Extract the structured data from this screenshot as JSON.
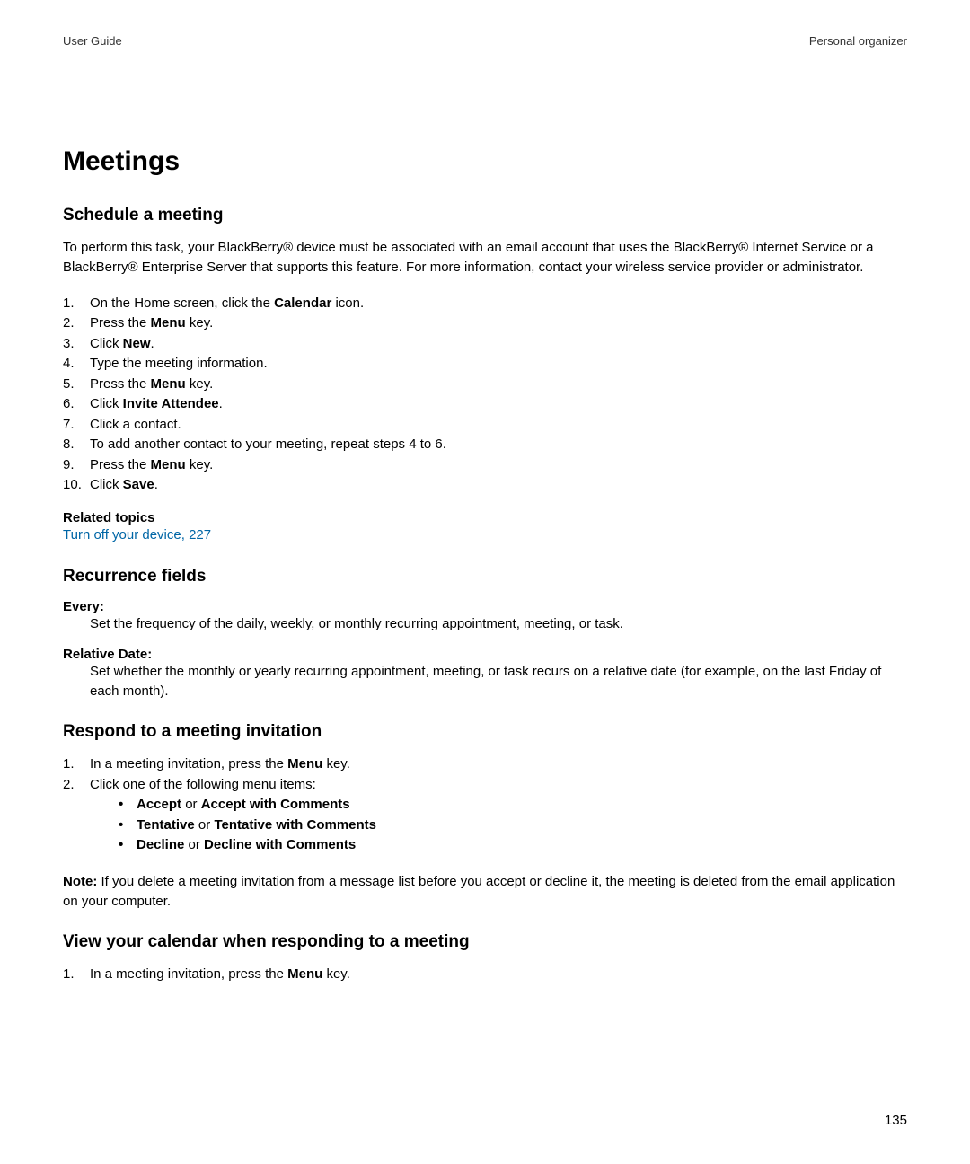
{
  "header": {
    "left": "User Guide",
    "right": "Personal organizer"
  },
  "title": "Meetings",
  "sections": {
    "schedule": {
      "heading": "Schedule a meeting",
      "intro": "To perform this task, your BlackBerry® device must be associated with an email account that uses the BlackBerry® Internet Service or a BlackBerry® Enterprise Server that supports this feature. For more information, contact your wireless service provider or administrator.",
      "steps": [
        {
          "pre": "On the Home screen, click the ",
          "bold": "Calendar",
          "post": " icon."
        },
        {
          "pre": "Press the ",
          "bold": "Menu",
          "post": " key."
        },
        {
          "pre": "Click ",
          "bold": "New",
          "post": "."
        },
        {
          "pre": "Type the meeting information.",
          "bold": "",
          "post": ""
        },
        {
          "pre": "Press the ",
          "bold": "Menu",
          "post": " key."
        },
        {
          "pre": "Click ",
          "bold": "Invite Attendee",
          "post": "."
        },
        {
          "pre": "Click a contact.",
          "bold": "",
          "post": ""
        },
        {
          "pre": "To add another contact to your meeting, repeat steps 4 to 6.",
          "bold": "",
          "post": ""
        },
        {
          "pre": "Press the ",
          "bold": "Menu",
          "post": " key."
        },
        {
          "pre": "Click ",
          "bold": "Save",
          "post": "."
        }
      ],
      "related_heading": "Related topics",
      "related_link": "Turn off your device, 227"
    },
    "recurrence": {
      "heading": "Recurrence fields",
      "defs": [
        {
          "term": "Every:",
          "def": "Set the frequency of the daily, weekly, or monthly recurring appointment, meeting, or task."
        },
        {
          "term": "Relative Date:",
          "def": "Set whether the monthly or yearly recurring appointment, meeting, or task recurs on a relative date (for example, on the last Friday of each month)."
        }
      ]
    },
    "respond": {
      "heading": "Respond to a meeting invitation",
      "steps": [
        {
          "pre": "In a meeting invitation, press the ",
          "bold": "Menu",
          "post": " key."
        },
        {
          "pre": "Click one of the following menu items:",
          "bold": "",
          "post": ""
        }
      ],
      "bullets": [
        {
          "b1": "Accept",
          "mid": " or ",
          "b2": "Accept with Comments"
        },
        {
          "b1": "Tentative",
          "mid": " or ",
          "b2": "Tentative with Comments"
        },
        {
          "b1": "Decline",
          "mid": " or ",
          "b2": "Decline with Comments"
        }
      ],
      "note_label": "Note:",
      "note_text": "  If you delete a meeting invitation from a message list before you accept or decline it, the meeting is deleted from the email application on your computer."
    },
    "viewcal": {
      "heading": "View your calendar when responding to a meeting",
      "steps": [
        {
          "pre": "In a meeting invitation, press the ",
          "bold": "Menu",
          "post": " key."
        }
      ]
    }
  },
  "page_number": "135"
}
